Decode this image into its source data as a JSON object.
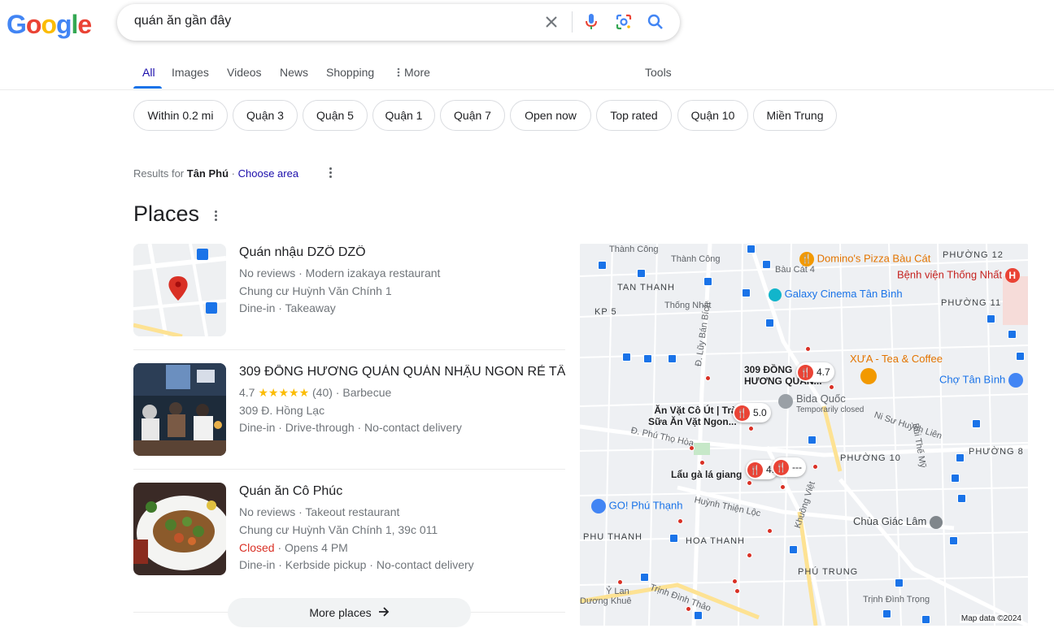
{
  "logo": {
    "letters": [
      "G",
      "o",
      "o",
      "g",
      "l",
      "e"
    ],
    "colors": [
      "#4285f4",
      "#ea4335",
      "#fbbc05",
      "#4285f4",
      "#34a853",
      "#ea4335"
    ]
  },
  "search": {
    "query": "quán ăn gần đây"
  },
  "tabs": {
    "all": "All",
    "images": "Images",
    "videos": "Videos",
    "news": "News",
    "shopping": "Shopping",
    "more": "More",
    "tools": "Tools"
  },
  "chips": [
    "Within 0.2 mi",
    "Quận 3",
    "Quận 5",
    "Quận 1",
    "Quận 7",
    "Open now",
    "Top rated",
    "Quận 10",
    "Miền Trung"
  ],
  "results_for": {
    "prefix": "Results for",
    "area": "Tân Phú",
    "separator": "·",
    "choose": "Choose area"
  },
  "places_title": "Places",
  "places": [
    {
      "name": "Quán nhậu DZÔ DZÔ",
      "line1": "No reviews · Modern izakaya restaurant",
      "line2": "Chung cư Huỳnh Văn Chính 1",
      "line3": "Dine-in · Takeaway"
    },
    {
      "name": "309 ĐỒNG HƯƠNG QUÁN QUÁN NHẬU NGON RẺ TÂ...",
      "rating": "4.7",
      "stars": "★★★★★",
      "rating_rest": "(40) · Barbecue",
      "line2": "309 Đ. Hồng Lạc",
      "line3": "Dine-in · Drive-through · No-contact delivery"
    },
    {
      "name": "Quán ăn Cô Phúc",
      "line1": "No reviews · Takeout restaurant",
      "line2": "Chung cư Huỳnh Văn Chính 1, 39c 011",
      "closed": "Closed",
      "opens": " · Opens 4 PM",
      "line3": "Dine-in · Kerbside pickup · No-contact delivery"
    }
  ],
  "more_places": "More places",
  "map": {
    "areas": [
      "KP 5",
      "TAN THANH",
      "PHƯỜNG 12",
      "PHƯỜNG 11",
      "PHƯỜNG 10",
      "PHƯỜNG 8",
      "PHU THANH",
      "HOA THANH",
      "PHÚ TRUNG"
    ],
    "streets": [
      "Thành Công",
      "Thành Công",
      "Bàu Cát 4",
      "Thống Nhất",
      "Đ. Lũy Bán Bích",
      "Đ. Phú Thọ Hòa",
      "Huỳnh Thiện Lộc",
      "Khuông Việt",
      "Trịnh Đình Thảo",
      "Trịnh Đình Trọng",
      "Ỷ Lan",
      "Dương Khuê",
      "Ni Sư Huỳnh Liên",
      "Bùi Thế Mỹ"
    ],
    "pois": {
      "dominos": "Domino's Pizza Bàu Cát",
      "hospital": "Bệnh viện Thống Nhất",
      "galaxy": "Galaxy Cinema Tân Bình",
      "xua": "XƯA - Tea & Coffee",
      "cho": "Chợ Tân Bình",
      "bida": "Bida Quốc",
      "bida_status": "Temporarily closed",
      "go": "GO! Phú Thạnh",
      "chua": "Chùa Giác Lâm"
    },
    "pins": [
      {
        "label": "309 ĐỒNG\nHƯƠNG QUÁN...",
        "value": "4.7"
      },
      {
        "label": "Ăn Vặt Cô Út | Trà\nSữa Ăn Vặt Ngon...",
        "value": "5.0"
      },
      {
        "label": "Lẩu gà lá giang",
        "value": "4."
      },
      {
        "label": "",
        "value": "---"
      }
    ],
    "attribution": "Map data ©2024"
  }
}
